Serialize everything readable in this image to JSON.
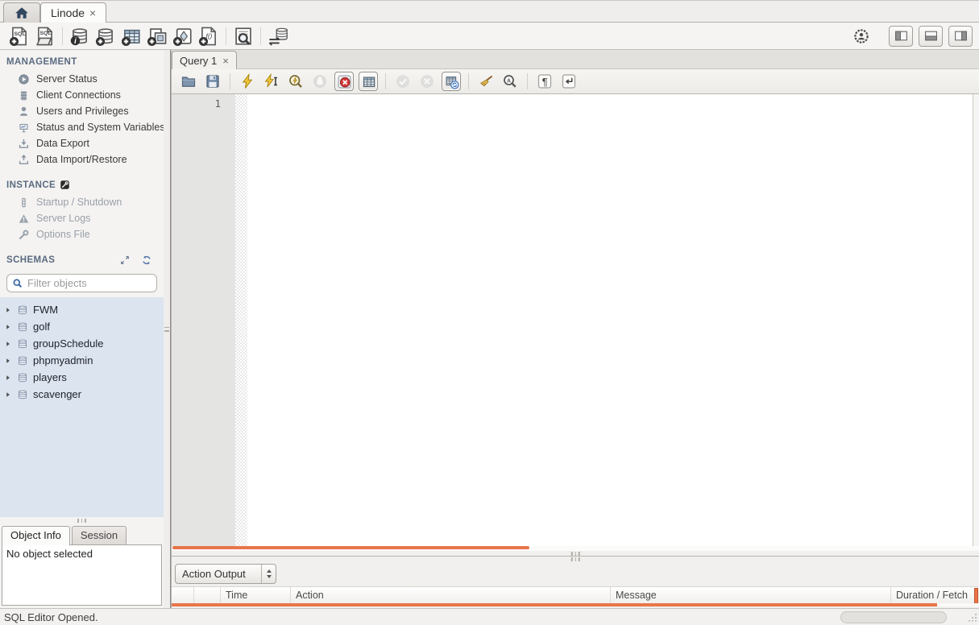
{
  "window": {
    "connection_tab": {
      "label": "Linode",
      "close_glyph": "×"
    }
  },
  "main_toolbar": {
    "left_icons": [
      "new-sql-tab-icon",
      "open-sql-script-icon",
      "schema-inspector-icon",
      "create-schema-icon",
      "create-table-icon",
      "create-view-icon",
      "create-procedure-icon",
      "create-function-icon",
      "search-data-icon",
      "reconnect-database-icon"
    ],
    "right_icons": [
      "preferences-icon",
      "toggle-left-sidebar-icon",
      "toggle-output-area-icon",
      "toggle-right-sidebar-icon"
    ]
  },
  "sidebar": {
    "management": {
      "title": "MANAGEMENT",
      "items": [
        {
          "label": "Server Status",
          "icon": "server-status-icon"
        },
        {
          "label": "Client Connections",
          "icon": "client-connections-icon"
        },
        {
          "label": "Users and Privileges",
          "icon": "users-icon"
        },
        {
          "label": "Status and System Variables",
          "icon": "status-variables-icon"
        },
        {
          "label": "Data Export",
          "icon": "data-export-icon"
        },
        {
          "label": "Data Import/Restore",
          "icon": "data-import-icon"
        }
      ]
    },
    "instance": {
      "title": "INSTANCE",
      "title_icon": "wrench-badge-icon",
      "items": [
        {
          "label": "Startup / Shutdown",
          "icon": "startup-shutdown-icon",
          "disabled": true
        },
        {
          "label": "Server Logs",
          "icon": "server-logs-icon",
          "disabled": true
        },
        {
          "label": "Options File",
          "icon": "options-file-icon",
          "disabled": true
        }
      ]
    },
    "schemas": {
      "title": "SCHEMAS",
      "header_icons": [
        "expand-panel-icon",
        "refresh-schemas-icon"
      ],
      "filter_placeholder": "Filter objects",
      "items": [
        "FWM",
        "golf",
        "groupSchedule",
        "phpmyadmin",
        "players",
        "scavenger"
      ]
    },
    "info_panel": {
      "tabs": [
        {
          "label": "Object Info",
          "active": true
        },
        {
          "label": "Session",
          "active": false
        }
      ],
      "content": "No object selected"
    }
  },
  "editor": {
    "tab": {
      "label": "Query 1",
      "close_glyph": "×"
    },
    "toolbar_icons": [
      "open-file-icon",
      "save-icon",
      "execute-icon",
      "execute-current-icon",
      "explain-icon",
      "stop-icon",
      "toggle-stop-on-error-icon",
      "limit-rows-icon",
      "commit-icon",
      "rollback-icon",
      "toggle-autocommit-icon",
      "beautify-icon",
      "find-icon",
      "show-invisibles-icon",
      "wrap-text-icon"
    ],
    "line_numbers": [
      "1"
    ],
    "content": ""
  },
  "output": {
    "view_selector": "Action Output",
    "columns": [
      "",
      "",
      "Time",
      "Action",
      "Message",
      "Duration / Fetch"
    ]
  },
  "status_bar": {
    "message": "SQL Editor Opened."
  },
  "colors": {
    "accent_orange": "#e8764a",
    "schema_list_bg": "#dce4ef",
    "section_title": "#5a6b80",
    "toolbar_bg": "#f5f4f2"
  }
}
